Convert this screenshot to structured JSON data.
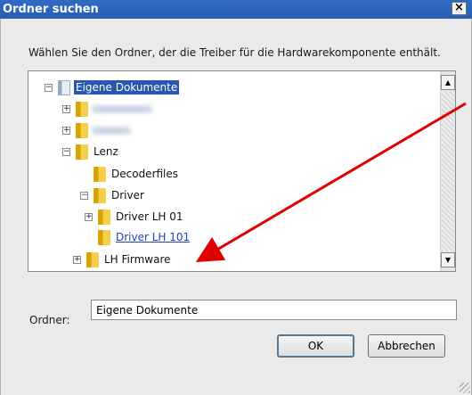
{
  "window": {
    "title": "Ordner suchen",
    "close_glyph": "×"
  },
  "instruction": "Wählen Sie den Ordner, der die Treiber für die Hardwarekomponente enthält.",
  "tree": {
    "rows": [
      {
        "label": "Eigene Dokumente",
        "expander": "−",
        "icon": "documents-folder-icon",
        "state": "selected"
      },
      {
        "label": "",
        "expander": "+",
        "icon": "folder-icon",
        "state": "blurred"
      },
      {
        "label": "",
        "expander": "+",
        "icon": "folder-icon",
        "state": "blurred"
      },
      {
        "label": "Lenz",
        "expander": "−",
        "icon": "folder-icon",
        "state": "normal"
      },
      {
        "label": "Decoderfiles",
        "expander": "",
        "icon": "folder-icon",
        "state": "normal"
      },
      {
        "label": "Driver",
        "expander": "−",
        "icon": "folder-icon",
        "state": "normal"
      },
      {
        "label": "Driver LH 01",
        "expander": "+",
        "icon": "folder-icon",
        "state": "normal"
      },
      {
        "label": "Driver LH 101",
        "expander": "",
        "icon": "folder-icon",
        "state": "highlighted"
      },
      {
        "label": "LH Firmware",
        "expander": "+",
        "icon": "folder-icon",
        "state": "normal"
      }
    ],
    "scroll_up_glyph": "▲",
    "scroll_down_glyph": "▼"
  },
  "folder_field": {
    "label": "Ordner:",
    "value": "Eigene Dokumente"
  },
  "buttons": {
    "ok": "OK",
    "cancel": "Abbrechen"
  },
  "colors": {
    "title_bar": "#2f6ac6",
    "selection": "#2a55b0",
    "annotation_arrow": "#e00000"
  }
}
